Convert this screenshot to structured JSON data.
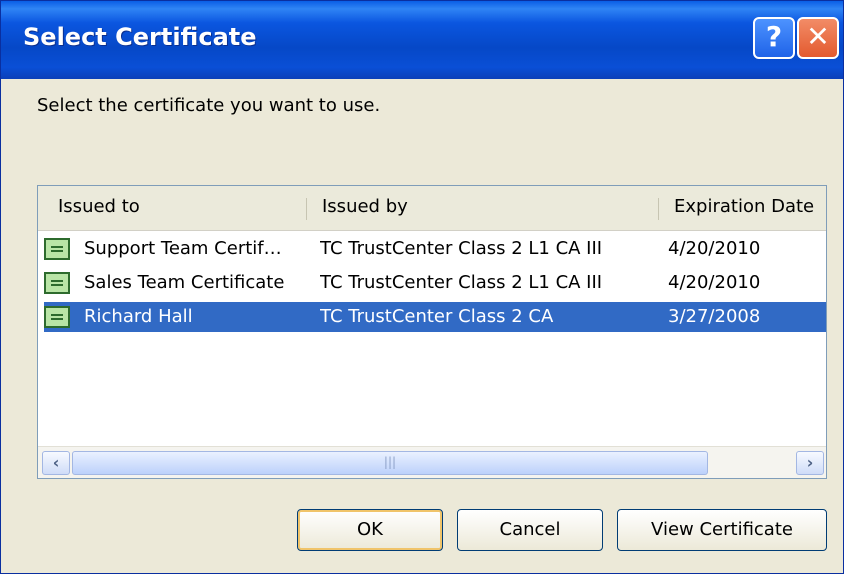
{
  "window": {
    "title": "Select Certificate",
    "help_glyph": "?",
    "close_glyph": "✕"
  },
  "prompt": "Select the certificate you want to use.",
  "columns": [
    "Issued to",
    "Issued by",
    "Expiration Date"
  ],
  "rows": [
    {
      "issued_to": "Support Team Certif…",
      "issued_by": "TC TrustCenter Class 2 L1 CA III",
      "expires": "4/20/2010",
      "icon": "certificate-icon"
    },
    {
      "issued_to": "Sales Team Certificate",
      "issued_by": "TC TrustCenter Class 2 L1 CA III",
      "expires": "4/20/2010",
      "icon": "certificate-icon"
    },
    {
      "issued_to": "Richard Hall",
      "issued_by": "TC TrustCenter Class 2 CA",
      "expires": "3/27/2008",
      "icon": "certificate-icon",
      "selected": true
    }
  ],
  "scrollbar": {
    "left_glyph": "‹",
    "right_glyph": "›",
    "thumb_grip": "|||"
  },
  "buttons": {
    "ok": "OK",
    "cancel": "Cancel",
    "view": "View Certificate"
  },
  "colors": {
    "selection": "#316ac5",
    "titlebar": "#0b56e0",
    "dialog": "#ece9d8"
  }
}
